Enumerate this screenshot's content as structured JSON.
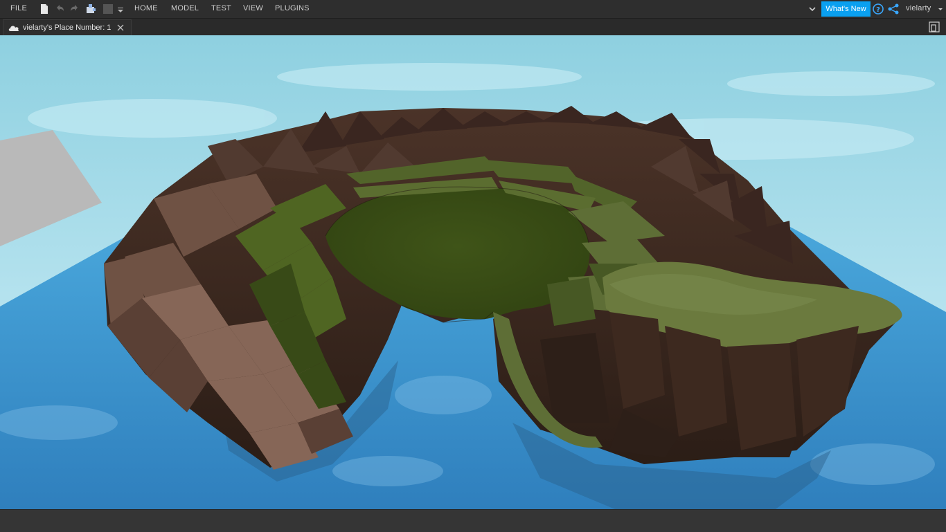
{
  "menubar": {
    "file_label": "FILE",
    "tabs": [
      {
        "label": "HOME"
      },
      {
        "label": "MODEL"
      },
      {
        "label": "TEST"
      },
      {
        "label": "VIEW"
      },
      {
        "label": "PLUGINS"
      }
    ],
    "whats_new_label": "What's New",
    "username": "vielarty"
  },
  "document_tab": {
    "title": "vielarty's Place Number: 1"
  },
  "colors": {
    "ui_background": "#2e2e2e",
    "accent": "#0aa0f0",
    "text": "#cfcfcf"
  },
  "icons": {
    "new_file": "file-icon",
    "undo": "undo-icon",
    "redo": "redo-icon",
    "publish": "puzzle-icon",
    "stop": "stop-icon",
    "customize": "dropdown-arrow-icon",
    "collapse": "chevron-down-icon",
    "help": "help-icon",
    "share": "share-icon",
    "user_menu": "caret-down-icon",
    "cloud": "cloud-icon",
    "close_tab": "close-icon",
    "device_emulator": "device-icon"
  }
}
